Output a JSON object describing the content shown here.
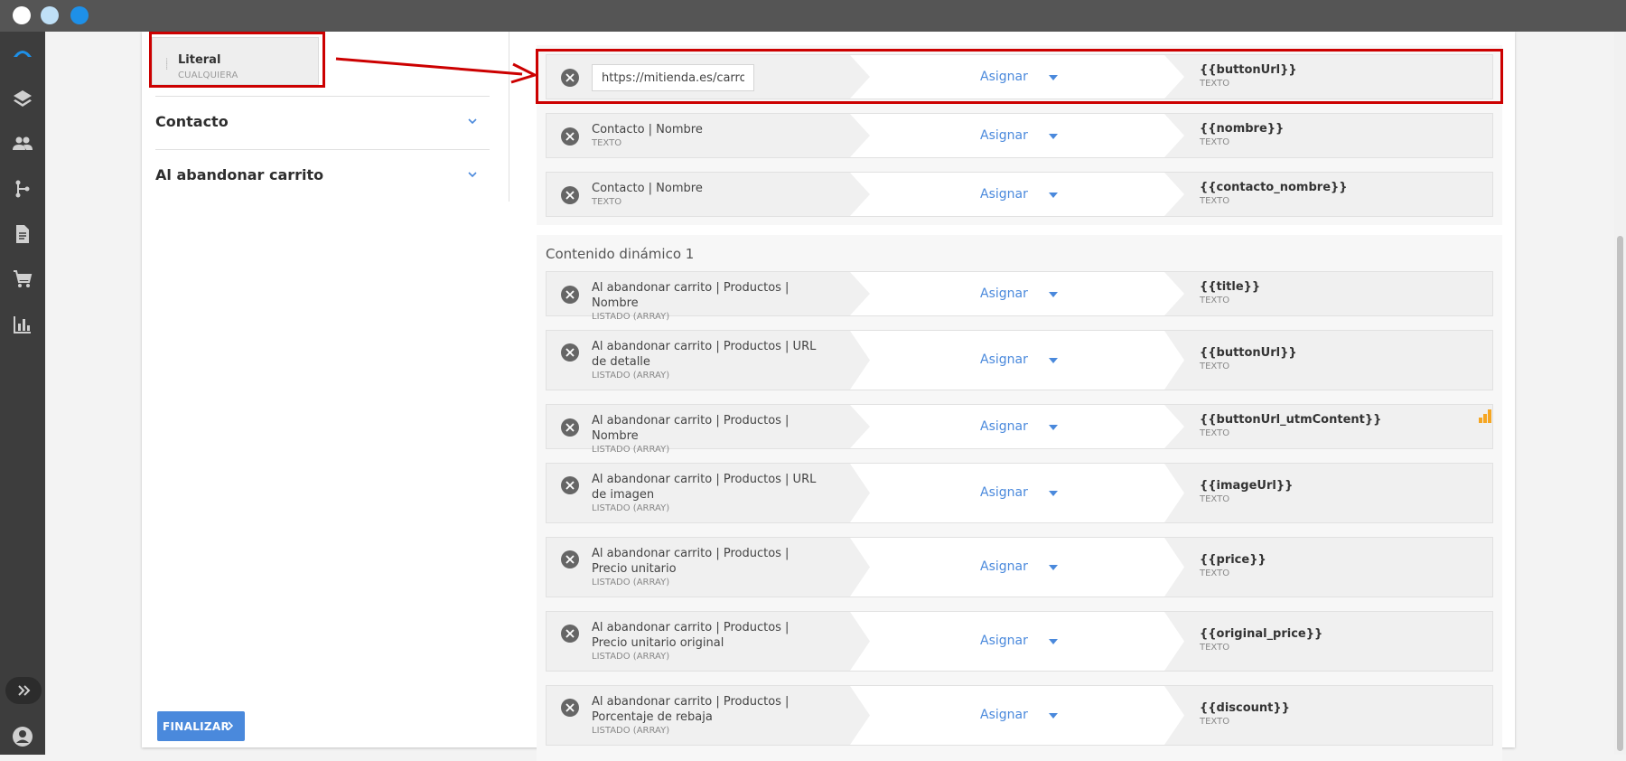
{
  "colors": {
    "accent": "#4a89dc",
    "highlight": "#cc0000",
    "sidebar": "#3d3d3d",
    "titlebar": "#555555",
    "badge": "#f5a623"
  },
  "window_dots": [
    "close",
    "minimize",
    "maximize"
  ],
  "nav": {
    "icons": [
      "logo-icon",
      "layers-icon",
      "users-icon",
      "flow-branch-icon",
      "document-icon",
      "cart-icon",
      "chart-icon"
    ]
  },
  "left": {
    "literal": {
      "title": "Literal",
      "subtitle": "CUALQUIERA"
    },
    "sections": [
      {
        "title": "Contacto"
      },
      {
        "title": "Al abandonar carrito"
      }
    ],
    "finish_label": "FINALIZAR"
  },
  "top_group": {
    "rows": [
      {
        "input_value": "https://mitienda.es/carro",
        "assign": "Asignar",
        "dst_title": "{{buttonUrl}}",
        "dst_sub": "TEXTO"
      },
      {
        "src_title": "Contacto | Nombre",
        "src_sub": "TEXTO",
        "assign": "Asignar",
        "dst_title": "{{nombre}}",
        "dst_sub": "TEXTO"
      },
      {
        "src_title": "Contacto | Nombre",
        "src_sub": "TEXTO",
        "assign": "Asignar",
        "dst_title": "{{contacto_nombre}}",
        "dst_sub": "TEXTO"
      }
    ]
  },
  "dynamic_group": {
    "title": "Contenido dinámico 1",
    "rows": [
      {
        "src_title": "Al abandonar carrito | Productos | Nombre",
        "src_sub": "LISTADO (ARRAY)",
        "assign": "Asignar",
        "dst_title": "{{title}}",
        "dst_sub": "TEXTO"
      },
      {
        "src_title": "Al abandonar carrito | Productos | URL de detalle",
        "src_sub": "LISTADO (ARRAY)",
        "assign": "Asignar",
        "dst_title": "{{buttonUrl}}",
        "dst_sub": "TEXTO"
      },
      {
        "src_title": "Al abandonar carrito | Productos | Nombre",
        "src_sub": "LISTADO (ARRAY)",
        "assign": "Asignar",
        "dst_title": "{{buttonUrl_utmContent}}",
        "dst_sub": "TEXTO"
      },
      {
        "src_title": "Al abandonar carrito | Productos | URL de imagen",
        "src_sub": "LISTADO (ARRAY)",
        "assign": "Asignar",
        "dst_title": "{{imageUrl}}",
        "dst_sub": "TEXTO"
      },
      {
        "src_title": "Al abandonar carrito | Productos | Precio unitario",
        "src_sub": "LISTADO (ARRAY)",
        "assign": "Asignar",
        "dst_title": "{{price}}",
        "dst_sub": "TEXTO"
      },
      {
        "src_title": "Al abandonar carrito | Productos | Precio unitario original",
        "src_sub": "LISTADO (ARRAY)",
        "assign": "Asignar",
        "dst_title": "{{original_price}}",
        "dst_sub": "TEXTO"
      },
      {
        "src_title": "Al abandonar carrito | Productos | Porcentaje de rebaja",
        "src_sub": "LISTADO (ARRAY)",
        "assign": "Asignar",
        "dst_title": "{{discount}}",
        "dst_sub": "TEXTO"
      }
    ]
  }
}
